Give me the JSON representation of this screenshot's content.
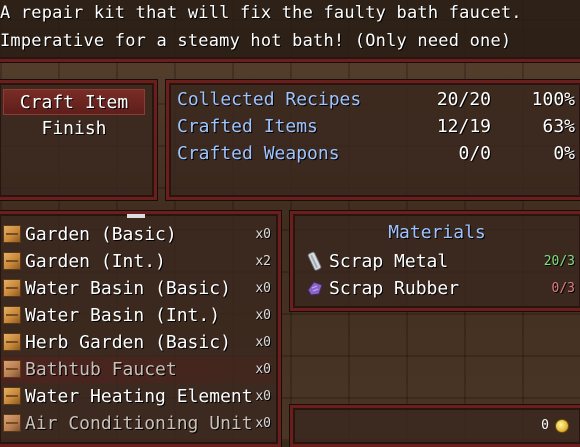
{
  "help": {
    "line1": "A repair kit that will fix the faulty bath faucet.",
    "line2": "Imperative for a steamy hot bath! (Only need one)"
  },
  "commands": [
    {
      "label": "Craft Item"
    },
    {
      "label": "Finish"
    }
  ],
  "stats": [
    {
      "label": "Collected Recipes",
      "count": "20/20",
      "percent": "100%"
    },
    {
      "label": "Crafted Items",
      "count": "12/19",
      "percent": "63%"
    },
    {
      "label": "Crafted Weapons",
      "count": "0/0",
      "percent": "0%"
    }
  ],
  "recipes": [
    {
      "name": "Garden (Basic)",
      "qty": "x0",
      "icon": "crate-icon"
    },
    {
      "name": "Garden (Int.)",
      "qty": "x2",
      "icon": "crate-icon"
    },
    {
      "name": "Water Basin (Basic)",
      "qty": "x0",
      "icon": "crate-icon"
    },
    {
      "name": "Water Basin (Int.)",
      "qty": "x0",
      "icon": "crate-icon"
    },
    {
      "name": "Herb Garden (Basic)",
      "qty": "x0",
      "icon": "crate-icon"
    },
    {
      "name": "Bathtub Faucet",
      "qty": "x0",
      "icon": "crate-icon"
    },
    {
      "name": "Water Heating Element",
      "qty": "x0",
      "icon": "crate-icon"
    },
    {
      "name": "Air Conditioning Unit",
      "qty": "x0",
      "icon": "crate-icon"
    }
  ],
  "materials": {
    "title": "Materials",
    "items": [
      {
        "name": "Scrap Metal",
        "count": "20/3",
        "count_color": "#7ee07e",
        "icon": "scrap-metal-icon"
      },
      {
        "name": "Scrap Rubber",
        "count": "0/3",
        "count_color": "#e07e7e",
        "icon": "scrap-rubber-icon"
      }
    ]
  },
  "gold": {
    "value": "0",
    "icon": "coin-icon"
  },
  "colors": {
    "label_blue": "#9ec4ff",
    "frame_red": "#6a1f1c"
  }
}
